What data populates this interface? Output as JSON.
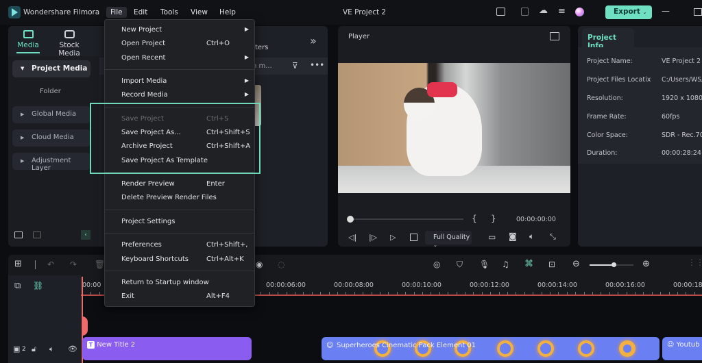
{
  "app": {
    "name": "Wondershare Filmora",
    "project_title": "VE Project 2",
    "export_label": "Export",
    "accent": "#6fe0c2"
  },
  "menubar": [
    {
      "label": "File"
    },
    {
      "label": "Edit"
    },
    {
      "label": "Tools"
    },
    {
      "label": "View"
    },
    {
      "label": "Help"
    }
  ],
  "media_tabs": [
    {
      "label": "Media",
      "icon": "media-icon"
    },
    {
      "label": "Stock Media",
      "icon": "stock-media-icon"
    },
    {
      "label": "ters"
    }
  ],
  "sidebar": {
    "items": [
      {
        "label": "Project Media"
      },
      {
        "label": "Folder"
      },
      {
        "label": "Global Media"
      },
      {
        "label": "Cloud Media"
      },
      {
        "label": "Adjustment Layer"
      }
    ]
  },
  "search": {
    "partial": "n m..."
  },
  "file_menu": [
    {
      "label": "New Project",
      "shortcut": "",
      "submenu": true
    },
    {
      "label": "Open Project",
      "shortcut": "Ctrl+O"
    },
    {
      "label": "Open Recent",
      "shortcut": "",
      "submenu": true
    },
    {
      "label": "Import Media",
      "shortcut": "",
      "submenu": true
    },
    {
      "label": "Record Media",
      "shortcut": "",
      "submenu": true
    },
    {
      "label": "Save Project",
      "shortcut": "Ctrl+S",
      "disabled": true
    },
    {
      "label": "Save Project As...",
      "shortcut": "Ctrl+Shift+S"
    },
    {
      "label": "Archive Project",
      "shortcut": "Ctrl+Shift+A"
    },
    {
      "label": "Save Project As Template",
      "shortcut": ""
    },
    {
      "label": "Render Preview",
      "shortcut": "Enter"
    },
    {
      "label": "Delete Preview Render Files",
      "shortcut": ""
    },
    {
      "label": "Project Settings",
      "shortcut": ""
    },
    {
      "label": "Preferences",
      "shortcut": "Ctrl+Shift+,"
    },
    {
      "label": "Keyboard Shortcuts",
      "shortcut": "Ctrl+Alt+K"
    },
    {
      "label": "Return to Startup window",
      "shortcut": ""
    },
    {
      "label": "Exit",
      "shortcut": "Alt+F4"
    }
  ],
  "player": {
    "title": "Player",
    "timecode": "00:00:00:00",
    "quality": "Full Quality",
    "progress": 0
  },
  "project_info": {
    "tab": "Project Info",
    "rows": [
      {
        "label": "Project Name:",
        "value": "VE Project 2"
      },
      {
        "label": "Project Files Locatix",
        "value": "C:/Users/WS/"
      },
      {
        "label": "Resolution:",
        "value": "1920 x 1080"
      },
      {
        "label": "Frame Rate:",
        "value": "60fps"
      },
      {
        "label": "Color Space:",
        "value": "SDR - Rec.709"
      },
      {
        "label": "Duration:",
        "value": "00:00:28:24"
      }
    ]
  },
  "timeline": {
    "ruler": [
      "00:00",
      "00:00:06:00",
      "00:00:08:00",
      "00:00:10:00",
      "00:00:12:00",
      "00:00:14:00",
      "00:00:16:00",
      "00:00:18"
    ],
    "track_number": "2",
    "zoom_level": 0.55,
    "clips": [
      {
        "label": "New Title 2",
        "color": "#8b5cf0"
      },
      {
        "label": "Superheroes Cinematic Pack Element 01",
        "color": "#6a7ff2"
      },
      {
        "label": "Youtub",
        "color": "#6a7ff2"
      }
    ]
  }
}
